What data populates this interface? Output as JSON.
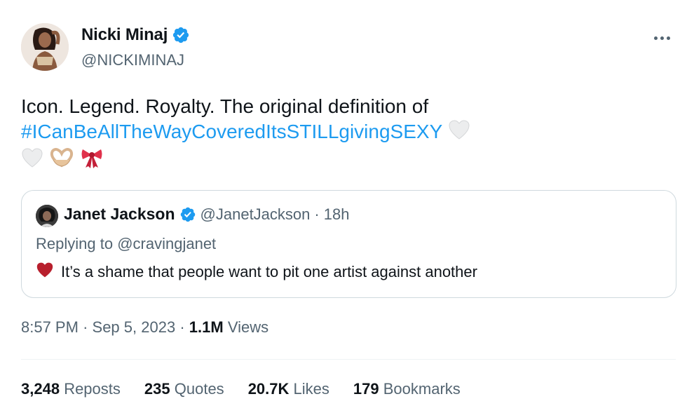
{
  "author": {
    "display_name": "Nicki Minaj",
    "handle": "@NICKIMINAJ",
    "verified": true
  },
  "tweet": {
    "text_line1": "Icon. Legend. Royalty. The original definition of",
    "hashtag": "#ICanBeAllTheWayCoveredItsSTILLgivingSEXY",
    "emojis": [
      "white-heart",
      "white-heart",
      "heart-hands",
      "ribbon"
    ]
  },
  "quoted": {
    "display_name": "Janet Jackson",
    "handle": "@JanetJackson",
    "separator": "·",
    "time": "18h",
    "replying_prefix": "Replying to",
    "replying_to": "@cravingjanet",
    "text": "It’s a shame that people want to pit one artist against another"
  },
  "meta": {
    "time": "8:57 PM",
    "separator": "·",
    "date": "Sep 5, 2023",
    "views_count": "1.1M",
    "views_label": "Views"
  },
  "stats": {
    "reposts": {
      "count": "3,248",
      "label": "Reposts"
    },
    "quotes": {
      "count": "235",
      "label": "Quotes"
    },
    "likes": {
      "count": "20.7K",
      "label": "Likes"
    },
    "bookmarks": {
      "count": "179",
      "label": "Bookmarks"
    }
  },
  "colors": {
    "link": "#1d9bf0",
    "secondary_text": "#536471",
    "verified": "#1d9bf0",
    "red_heart": "#c0272d"
  }
}
